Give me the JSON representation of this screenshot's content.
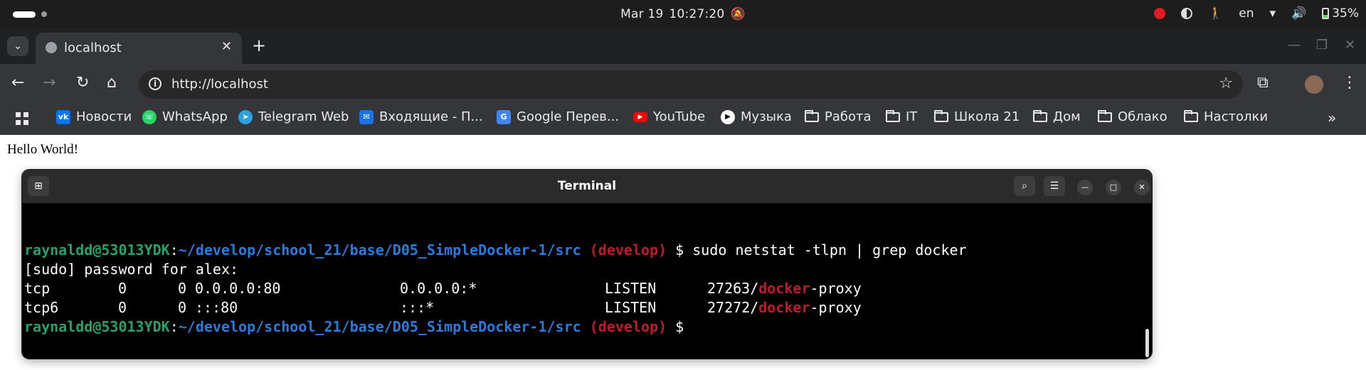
{
  "system_bar": {
    "date": "Mar 19",
    "time": "10:27:20",
    "language": "en",
    "battery": "35%"
  },
  "browser": {
    "tab_title": "localhost",
    "url": "http://localhost",
    "bookmarks": [
      {
        "label": "Новости",
        "icon": "vk-icon",
        "color": "#0077ff"
      },
      {
        "label": "WhatsApp",
        "icon": "whatsapp-icon",
        "color": "#25d366"
      },
      {
        "label": "Telegram Web",
        "icon": "telegram-icon",
        "color": "#2aa3df"
      },
      {
        "label": "Входящие - П...",
        "icon": "mail-icon",
        "color": "#1a73e8"
      },
      {
        "label": "Google Перев...",
        "icon": "translate-icon",
        "color": "#4285f4"
      },
      {
        "label": "YouTube",
        "icon": "youtube-icon",
        "color": "#ff0000"
      },
      {
        "label": "Музыка",
        "icon": "music-icon",
        "color": "#ffffff"
      },
      {
        "label": "Работа",
        "icon": "folder-icon"
      },
      {
        "label": "IT",
        "icon": "folder-icon"
      },
      {
        "label": "Школа 21",
        "icon": "folder-icon"
      },
      {
        "label": "Дом",
        "icon": "folder-icon"
      },
      {
        "label": "Облако",
        "icon": "folder-icon"
      },
      {
        "label": "Настолки",
        "icon": "folder-icon"
      }
    ]
  },
  "page": {
    "text": "Hello World!"
  },
  "terminal": {
    "title": "Terminal",
    "prompt_user": "raynaldd@53013YDK",
    "prompt_sep": ":",
    "prompt_path": "~/develop/school_21/base/D05_SimpleDocker-1/src",
    "prompt_branch": "(develop)",
    "prompt_symbol": "$",
    "command": "sudo netstat -tlpn | grep docker",
    "sudo_line": "[sudo] password for alex:",
    "rows": [
      {
        "proto": "tcp",
        "recv": "0",
        "send": "0",
        "local": "0.0.0.0:80",
        "foreign": "0.0.0.0:*",
        "state": "LISTEN",
        "pid": "27263/",
        "prog_match": "docker",
        "prog_rest": "-proxy"
      },
      {
        "proto": "tcp6",
        "recv": "0",
        "send": "0",
        "local": ":::80",
        "foreign": ":::*",
        "state": "LISTEN",
        "pid": "27272/",
        "prog_match": "docker",
        "prog_rest": "-proxy"
      }
    ]
  },
  "colors": {
    "prompt_user": "#26a269",
    "prompt_path": "#2a7bde",
    "prompt_branch": "#c01c28"
  }
}
